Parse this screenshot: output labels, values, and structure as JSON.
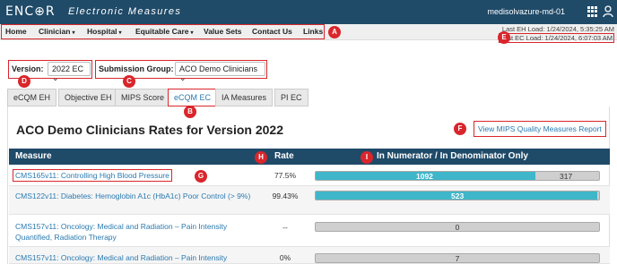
{
  "header": {
    "brand": "ENC⊕R",
    "brand_sub": "Electronic Measures",
    "server": "medisolvazure-md-01",
    "grid_icon": "apps-grid-icon",
    "user_icon": "user-icon"
  },
  "nav": {
    "items": [
      {
        "label": "Home",
        "has_caret": false
      },
      {
        "label": "Clinician",
        "has_caret": true
      },
      {
        "label": "Hospital",
        "has_caret": true
      },
      {
        "label": "Equitable Care",
        "has_caret": true
      },
      {
        "label": "Value Sets",
        "has_caret": false
      },
      {
        "label": "Contact Us",
        "has_caret": false
      },
      {
        "label": "Links",
        "has_caret": false
      }
    ],
    "caret_glyph": "▾"
  },
  "load_info": {
    "eh": "Last EH Load: 1/24/2024, 5:35:25 AM",
    "ec": "Last EC Load: 1/24/2024, 6:07:03 AM"
  },
  "filters": {
    "version_label": "Version:",
    "version_value": "2022 EC",
    "group_label": "Submission Group:",
    "group_value": "ACO Demo Clinicians",
    "chevron": "⌄"
  },
  "tabs": [
    {
      "label": "eCQM EH",
      "active": false
    },
    {
      "label": "Objective EH",
      "active": false
    },
    {
      "label": "MIPS Score",
      "active": false
    },
    {
      "label": "eCQM EC",
      "active": true
    },
    {
      "label": "IA Measures",
      "active": false
    },
    {
      "label": "PI EC",
      "active": false
    }
  ],
  "main": {
    "title": "ACO Demo Clinicians Rates for Version 2022",
    "report_link": "View MIPS Quality Measures Report"
  },
  "table": {
    "columns": [
      "Measure",
      "Rate",
      "In Numerator / In Denominator Only"
    ],
    "rows": [
      {
        "measure": "CMS165v11: Controlling High Blood Pressure",
        "rate": "77.5%",
        "numerator": "1092",
        "denominator_only": "317",
        "fill": 0.775
      },
      {
        "measure": "CMS122v11: Diabetes: Hemoglobin A1c (HbA1c) Poor Control (> 9%)",
        "rate": "99.43%",
        "numerator": "523",
        "denominator_only": "",
        "fill": 0.994
      },
      {
        "measure": "CMS157v11: Oncology: Medical and Radiation – Pain Intensity Quantified, Radiation Therapy",
        "rate": "--",
        "numerator": "",
        "denominator_only": "0",
        "fill": 0
      },
      {
        "measure": "CMS157v11: Oncology: Medical and Radiation – Pain Intensity",
        "rate": "0%",
        "numerator": "",
        "denominator_only": "7",
        "fill": 0
      }
    ]
  },
  "callouts": [
    "A",
    "B",
    "C",
    "D",
    "E",
    "F",
    "G",
    "H",
    "I"
  ],
  "colors": {
    "header_bg": "#1f4a68",
    "accent_red": "#d9262c",
    "bar_fill": "#3fb6c9",
    "link": "#2a7ab0"
  }
}
